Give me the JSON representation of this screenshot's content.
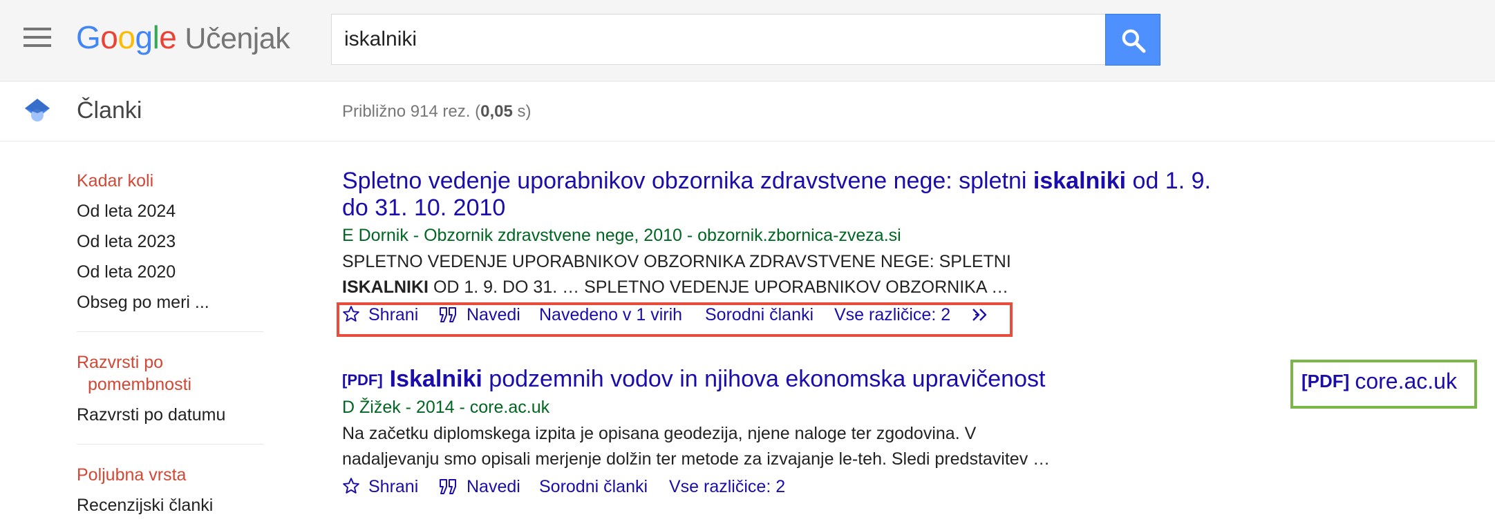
{
  "header": {
    "logo_letters": [
      "G",
      "o",
      "o",
      "g",
      "l",
      "e"
    ],
    "logo_suffix": "Učenjak",
    "search_value": "iskalniki"
  },
  "subheader": {
    "section_title": "Članki",
    "result_stats_prefix": "Približno 914 rez. (",
    "result_stats_time": "0,05",
    "result_stats_suffix": " s)"
  },
  "sidebar": {
    "time_filters": [
      "Kadar koli",
      "Od leta 2024",
      "Od leta 2023",
      "Od leta 2020",
      "Obseg po meri ..."
    ],
    "sort_relevance_line1": "Razvrsti po",
    "sort_relevance_line2": "pomembnosti",
    "sort_date": "Razvrsti po datumu",
    "type_any": "Poljubna vrsta",
    "type_reviews": "Recenzijski članki"
  },
  "results": [
    {
      "title_pre": "Spletno vedenje uporabnikov obzornika zdravstvene nege: spletni ",
      "title_bold": "iskalniki",
      "title_post": " od 1. 9. do 31. 10. 2010",
      "meta": "E Dornik - Obzornik zdravstvene nege, 2010 - obzornik.zbornica-zveza.si",
      "snippet_line1": "SPLETNO VEDENJE UPORABNIKOV OBZORNIKA ZDRAVSTVENE NEGE: SPLETNI",
      "snippet_line2_bold": "ISKALNIKI",
      "snippet_line2_rest": " OD 1. 9. DO 31. … SPLETNO VEDENJE UPORABNIKOV OBZORNIKA …",
      "actions": {
        "save": "Shrani",
        "cite": "Navedi",
        "cited_by": "Navedeno v 1 virih",
        "related": "Sorodni članki",
        "versions": "Vse različice: 2"
      }
    },
    {
      "pdf_tag": "[PDF]",
      "title_bold": "Iskalniki",
      "title_post": " podzemnih vodov in njihova ekonomska upravičenost",
      "meta": "D Žižek - 2014 - core.ac.uk",
      "snippet_line1": "Na začetku diplomskega izpita je opisana geodezija, njene naloge ter zgodovina. V",
      "snippet_line2": "nadaljevanju smo opisali merjenje dolžin ter metode za izvajanje le-teh. Sledi predstavitev …",
      "actions": {
        "save": "Shrani",
        "cite": "Navedi",
        "related": "Sorodni članki",
        "versions": "Vse različice: 2"
      },
      "side_link_tag": "[PDF]",
      "side_link_domain": "core.ac.uk"
    }
  ],
  "colors": {
    "link": "#1a0dab",
    "meta_green": "#006621",
    "active_red": "#d14836",
    "search_button": "#4d90fe",
    "highlight_red": "#e74c3c",
    "highlight_green": "#7ab648"
  },
  "icons": [
    "menu-icon",
    "search-icon",
    "graduation-cap-icon",
    "star-icon",
    "quote-icon",
    "more-chevrons-icon"
  ]
}
